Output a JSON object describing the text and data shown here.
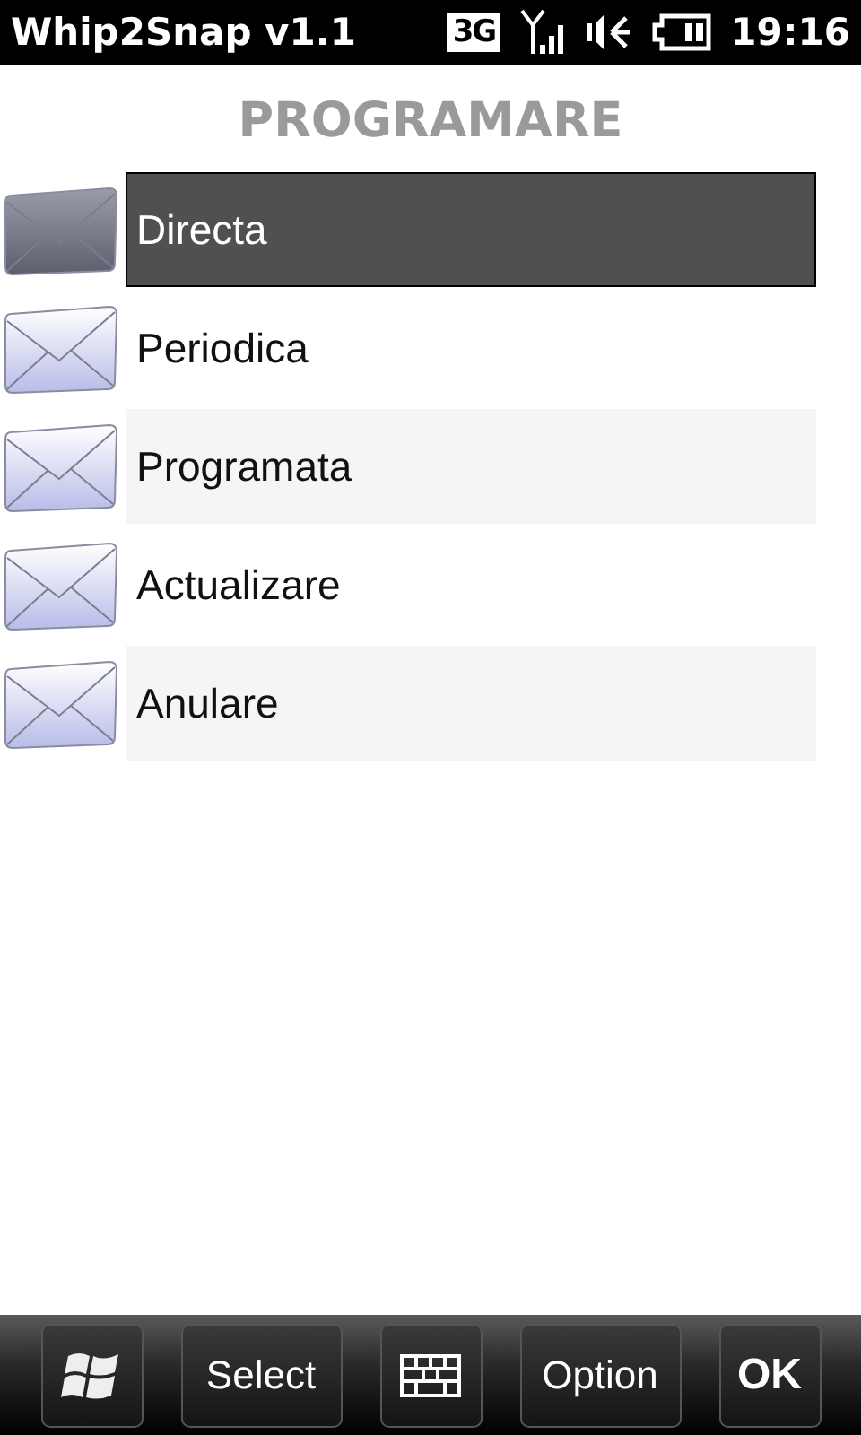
{
  "status_bar": {
    "app_title": "Whip2Snap v1.1",
    "network": "3G",
    "time": "19:16"
  },
  "title": "PROGRAMARE",
  "items": [
    {
      "label": "Directa",
      "selected": true
    },
    {
      "label": "Periodica",
      "selected": false
    },
    {
      "label": "Programata",
      "selected": false
    },
    {
      "label": "Actualizare",
      "selected": false
    },
    {
      "label": "Anulare",
      "selected": false
    }
  ],
  "softkeys": [
    {
      "kind": "start"
    },
    {
      "kind": "text",
      "label": "Select"
    },
    {
      "kind": "keyboard"
    },
    {
      "kind": "text",
      "label": "Option"
    },
    {
      "kind": "ok",
      "label": "OK"
    }
  ]
}
